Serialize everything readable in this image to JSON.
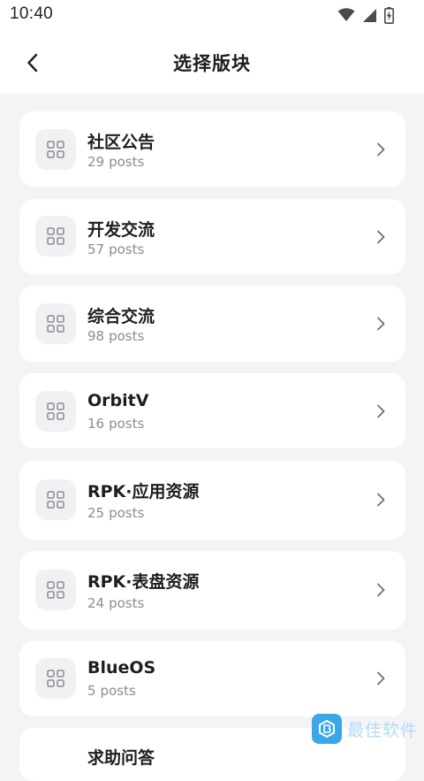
{
  "status_bar": {
    "time": "10:40",
    "icons": [
      "wifi-icon",
      "signal-icon",
      "battery-charging-icon"
    ]
  },
  "header": {
    "back_icon": "chevron-left-icon",
    "title": "选择版块"
  },
  "boards": [
    {
      "name": "社区公告",
      "count": "29",
      "unit": "posts"
    },
    {
      "name": "开发交流",
      "count": "57",
      "unit": "posts"
    },
    {
      "name": "综合交流",
      "count": "98",
      "unit": "posts"
    },
    {
      "name": "OrbitV",
      "count": "16",
      "unit": "posts"
    },
    {
      "name": "RPK·应用资源",
      "count": "25",
      "unit": "posts"
    },
    {
      "name": "RPK·表盘资源",
      "count": "24",
      "unit": "posts"
    },
    {
      "name": "BlueOS",
      "count": "5",
      "unit": "posts"
    },
    {
      "name": "求助问答",
      "count": "",
      "unit": ""
    }
  ],
  "board_icon": "grid-icon",
  "row_chevron_icon": "chevron-right-icon",
  "watermark": {
    "text": "最佳软件",
    "badge_icon": "watermark-logo-icon"
  },
  "colors": {
    "background": "#f4f4f7",
    "card": "#ffffff",
    "icon_tile": "#f1f1f4",
    "subtext": "#8c8c93",
    "watermark_accent": "#3aa7e8"
  }
}
